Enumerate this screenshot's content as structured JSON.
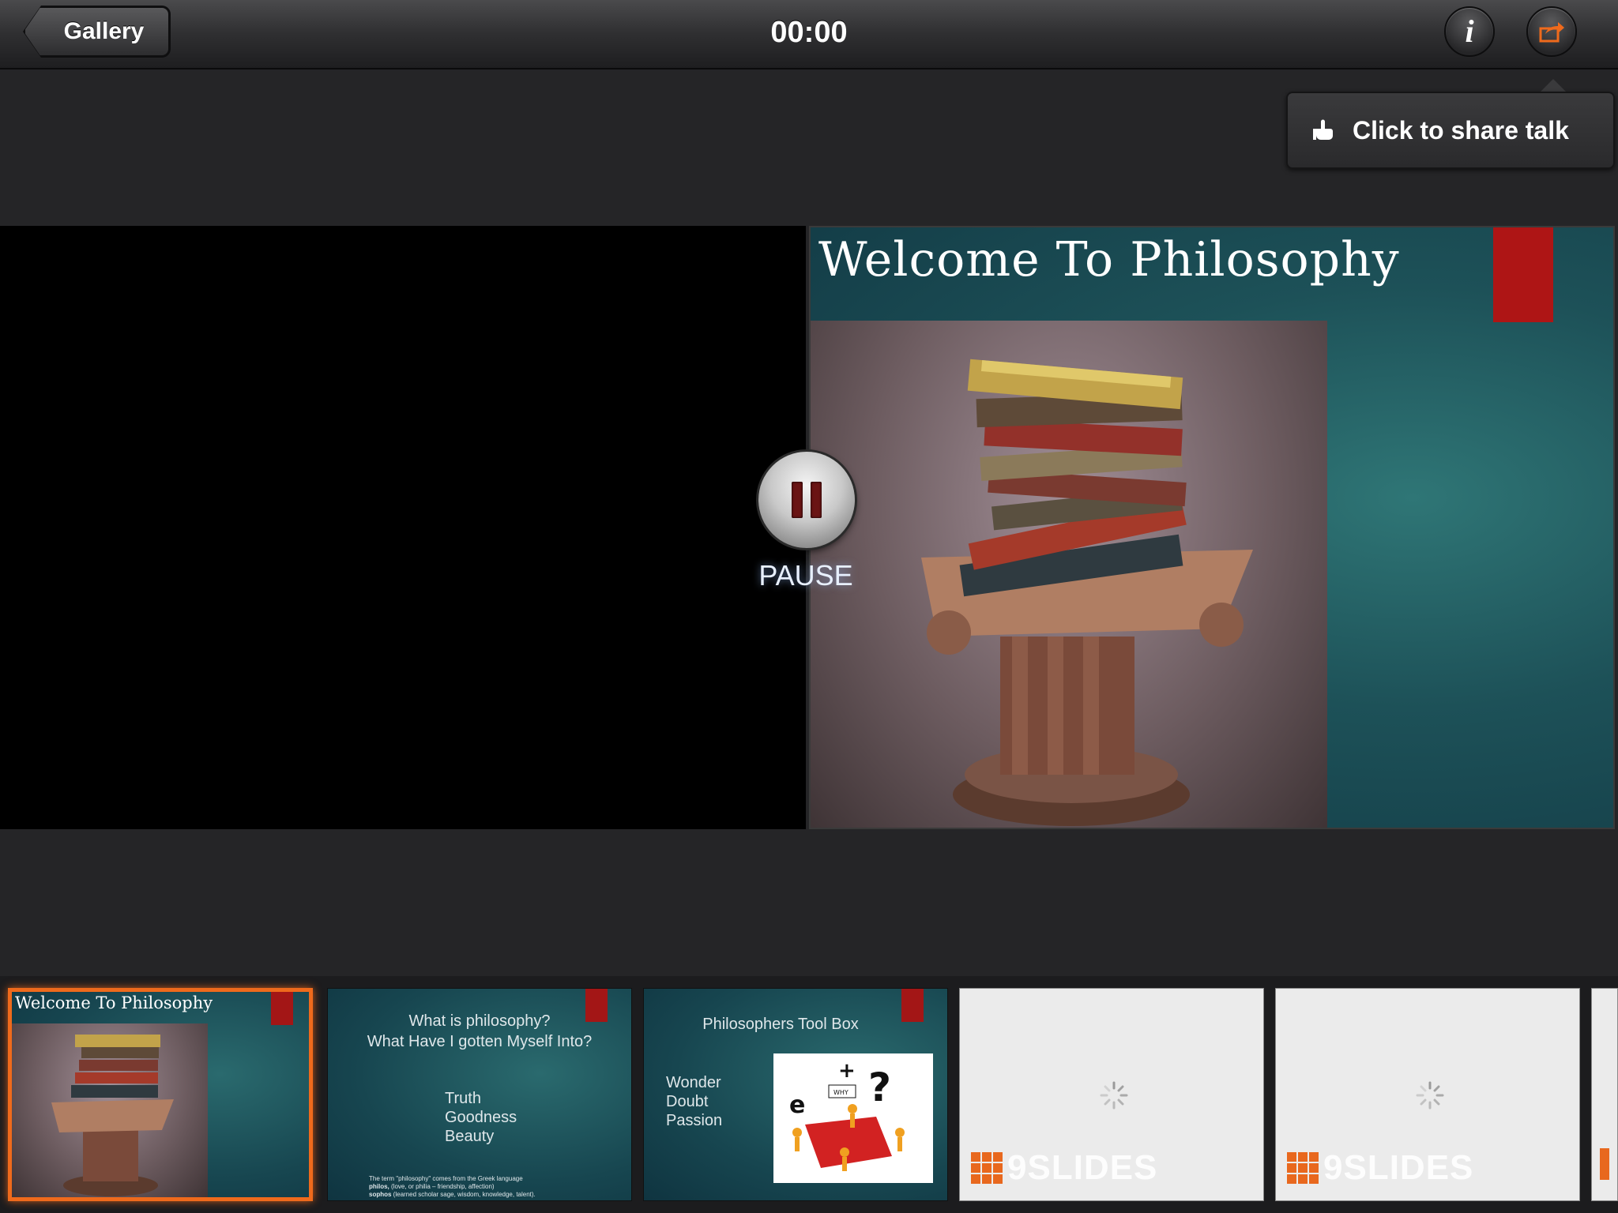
{
  "header": {
    "back_label": "Gallery",
    "timer": "00:00"
  },
  "share_tooltip": {
    "text": "Click to share talk"
  },
  "current_slide": {
    "title": "Welcome To Philosophy"
  },
  "playback": {
    "pause_label": "PAUSE"
  },
  "thumbnails": [
    {
      "title": "Welcome To Philosophy",
      "selected": true
    },
    {
      "title_line1": "What is philosophy?",
      "title_line2": "What Have I gotten Myself Into?",
      "items": [
        "Truth",
        "Goodness",
        "Beauty"
      ],
      "note_line1": "The term \"philosophy\" comes from the Greek language",
      "note_line2_term": "philos,",
      "note_line2_rest": " (love, or philia – friendship, affection)",
      "note_line3_term": "sophos",
      "note_line3_rest": " (learned scholar sage, wisdom, knowledge, talent)."
    },
    {
      "title": "Philosophers Tool Box",
      "items": [
        "Wonder",
        "Doubt",
        "Passion"
      ],
      "image_caption": "WHY"
    },
    {
      "brand": "9SLIDES"
    },
    {
      "brand": "9SLIDES"
    }
  ],
  "colors": {
    "accent_orange": "#ef6a1c",
    "slide_red": "#ae1515",
    "slide_teal": "#1d5158"
  },
  "icons": {
    "back": "chevron-left-icon",
    "info": "info-icon",
    "share": "share-icon",
    "tooltip": "pointing-hand-icon",
    "pause": "pause-icon",
    "loading": "spinner-icon"
  }
}
